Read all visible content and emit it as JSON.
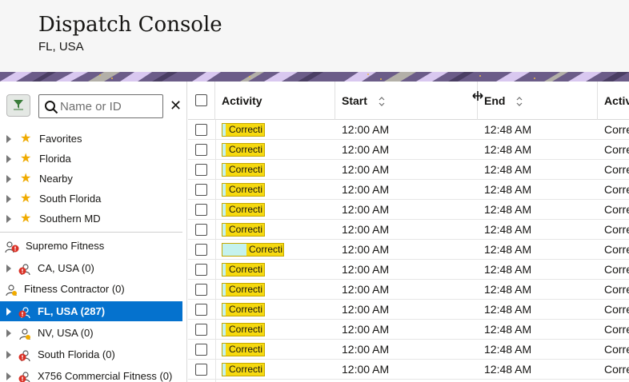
{
  "header": {
    "title": "Dispatch Console",
    "subtitle": "FL, USA"
  },
  "search": {
    "placeholder": "Name or ID",
    "clear_glyph": "✕"
  },
  "tree": {
    "favorites": [
      "Favorites",
      "Florida",
      "Nearby",
      "South Florida",
      "Southern MD"
    ],
    "org": "Supremo Fitness",
    "ca": "CA, USA (0)",
    "contractor": "Fitness Contractor (0)",
    "fl": "FL, USA (287)",
    "nv": "NV, USA (0)",
    "sfl": "South Florida (0)",
    "x756": "X756 Commercial Fitness (0)"
  },
  "grid": {
    "columns": {
      "activity": "Activity",
      "start": "Start",
      "end": "End",
      "activity2": "Activ"
    },
    "rows": [
      {
        "activity": "Correcti",
        "start": "12:00 AM",
        "end": "12:48 AM",
        "type": "Corre"
      },
      {
        "activity": "Correcti",
        "start": "12:00 AM",
        "end": "12:48 AM",
        "type": "Corre"
      },
      {
        "activity": "Correcti",
        "start": "12:00 AM",
        "end": "12:48 AM",
        "type": "Corre"
      },
      {
        "activity": "Correcti",
        "start": "12:00 AM",
        "end": "12:48 AM",
        "type": "Corre"
      },
      {
        "activity": "Correcti",
        "start": "12:00 AM",
        "end": "12:48 AM",
        "type": "Corre"
      },
      {
        "activity": "Correcti",
        "start": "12:00 AM",
        "end": "12:48 AM",
        "type": "Corre"
      },
      {
        "activity": "Correcti",
        "start": "12:00 AM",
        "end": "12:48 AM",
        "type": "Corre"
      },
      {
        "activity": "Correcti",
        "start": "12:00 AM",
        "end": "12:48 AM",
        "type": "Corre"
      },
      {
        "activity": "Correcti",
        "start": "12:00 AM",
        "end": "12:48 AM",
        "type": "Corre"
      },
      {
        "activity": "Correcti",
        "start": "12:00 AM",
        "end": "12:48 AM",
        "type": "Corre"
      },
      {
        "activity": "Correcti",
        "start": "12:00 AM",
        "end": "12:48 AM",
        "type": "Corre"
      },
      {
        "activity": "Correcti",
        "start": "12:00 AM",
        "end": "12:48 AM",
        "type": "Corre"
      },
      {
        "activity": "Correcti",
        "start": "12:00 AM",
        "end": "12:48 AM",
        "type": "Corre"
      }
    ]
  },
  "colors": {
    "selected": "#0572ce",
    "chip": "#f6d90f",
    "chip_progress": "#c4f2ee",
    "star": "#f0ab00",
    "alert": "#d93025"
  },
  "icons": [
    "filter-icon",
    "search-icon",
    "close-icon",
    "star-icon",
    "org-icon",
    "alert-user-icon",
    "user-icon",
    "expand-triangle-icon",
    "sort-icon",
    "resize-cursor-icon"
  ]
}
